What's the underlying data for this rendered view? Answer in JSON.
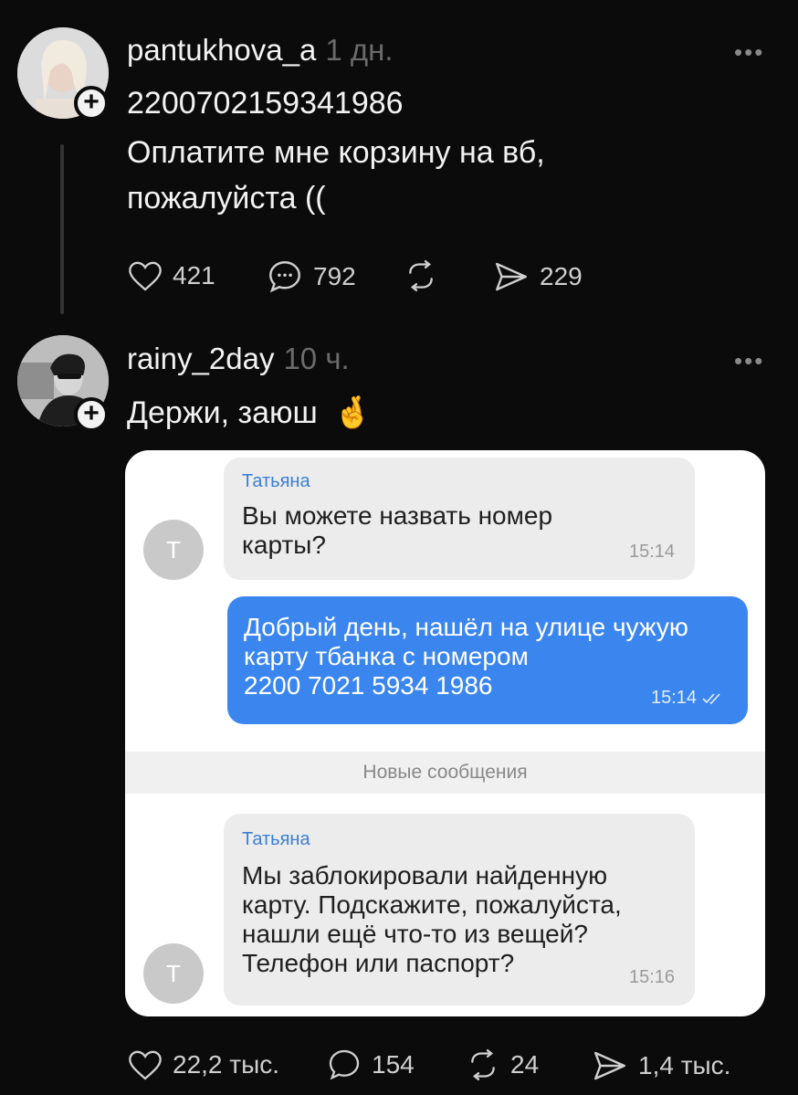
{
  "post1": {
    "username": "pantukhova_a",
    "time": "1 дн.",
    "line1": "2200702159341986",
    "line2": "Оплатите мне корзину на вб,",
    "line3": "пожалуйста ((",
    "likes": "421",
    "comments": "792",
    "shares": "229"
  },
  "post2": {
    "username": "rainy_2day",
    "time": "10 ч.",
    "text": "Держи, заюш",
    "emoji": "🤞",
    "likes": "22,2 тыс.",
    "comments": "154",
    "reposts": "24",
    "shares": "1,4 тыс."
  },
  "more_label": "•••",
  "chat": {
    "avatar_letter": "Т",
    "msg1_sender": "Татьяна",
    "msg1_line1": "Вы можете назвать номер",
    "msg1_line2": "карты?",
    "msg1_time": "15:14",
    "msg2_line1": "Добрый день, нашёл на улице чужую",
    "msg2_line2": "карту тбанка с номером",
    "msg2_line3": "2200 7021 5934 1986",
    "msg2_time": "15:14",
    "divider": "Новые сообщения",
    "msg3_sender": "Татьяна",
    "msg3_line1": "Мы заблокировали найденную",
    "msg3_line2": "карту. Подскажите, пожалуйста,",
    "msg3_line3": "нашли ещё что-то из вещей?",
    "msg3_line4": "Телефон или паспорт?",
    "msg3_time": "15:16"
  }
}
